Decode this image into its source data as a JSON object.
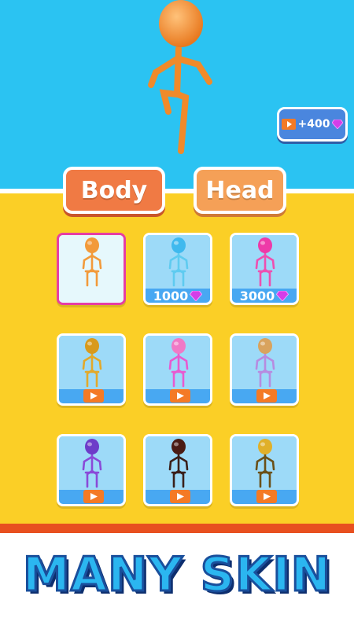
{
  "colors": {
    "sky": "#2bc3f2",
    "ground": "#fbcf26",
    "strip": "#e8501f",
    "tab_body": "#f07a44",
    "tab_head": "#f5a057",
    "card_blue": "#48a8f2",
    "selected_border": "#e63ea3",
    "title_fill": "#2bb6f0",
    "title_outline": "#1a4f9c"
  },
  "reward_button": {
    "label": "+400",
    "icons": [
      "play-icon",
      "gem-icon"
    ]
  },
  "tabs": [
    {
      "label": "Body",
      "active": true
    },
    {
      "label": "Head",
      "active": false
    }
  ],
  "skins": [
    {
      "color": "#f29a3a",
      "head_color": "#f29a3a",
      "selected": true,
      "unlock": "owned"
    },
    {
      "color": "#5fcbf0",
      "head_color": "#3fb9ee",
      "selected": false,
      "unlock": "price",
      "price": "1000",
      "icon": "gem-icon"
    },
    {
      "color": "#ee4fb0",
      "head_color": "#ee3aa8",
      "selected": false,
      "unlock": "price",
      "price": "3000",
      "icon": "gem-icon"
    },
    {
      "color": "#e3a92a",
      "head_color": "#d89a1c",
      "selected": false,
      "unlock": "video",
      "icon": "play-icon"
    },
    {
      "color": "#e85ad0",
      "head_color": "#f07ac6",
      "selected": false,
      "unlock": "video",
      "icon": "play-icon"
    },
    {
      "color": "#b78be0",
      "head_color": "#d9a35e",
      "selected": false,
      "unlock": "video",
      "icon": "play-icon"
    },
    {
      "color": "#8a4ad8",
      "head_color": "#6d3cc9",
      "selected": false,
      "unlock": "video",
      "icon": "play-icon"
    },
    {
      "color": "#3a1f1a",
      "head_color": "#4a1c14",
      "selected": false,
      "unlock": "video",
      "icon": "play-icon"
    },
    {
      "color": "#6a5018",
      "head_color": "#e0b02a",
      "selected": false,
      "unlock": "video",
      "icon": "play-icon"
    }
  ],
  "banner": {
    "text": "MANY SKIN"
  }
}
